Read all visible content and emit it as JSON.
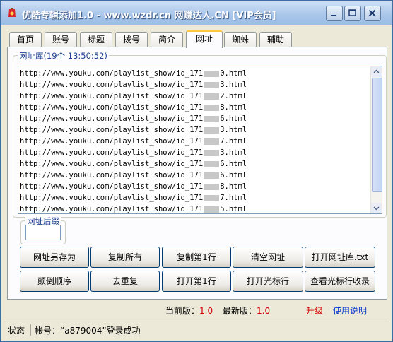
{
  "window": {
    "title": "优酷专辑添加1.0 - www.wzdr.cn 网赚达人.CN [VIP会员]"
  },
  "tabs": [
    "首页",
    "账号",
    "标题",
    "拨号",
    "简介",
    "网址",
    "蜘蛛",
    "辅助"
  ],
  "active_tab": "网址",
  "url_group": {
    "title": "网址库(19个 13:50:52)",
    "rows": [
      {
        "prefix": "http://www.youku.com/playlist_show/id_171",
        "suffix": "0.html"
      },
      {
        "prefix": "http://www.youku.com/playlist_show/id_171",
        "suffix": "3.html"
      },
      {
        "prefix": "http://www.youku.com/playlist_show/id_171",
        "suffix": "2.html"
      },
      {
        "prefix": "http://www.youku.com/playlist_show/id_171",
        "suffix": "8.html"
      },
      {
        "prefix": "http://www.youku.com/playlist_show/id_171",
        "suffix": "6.html"
      },
      {
        "prefix": "http://www.youku.com/playlist_show/id_171",
        "suffix": "3.html"
      },
      {
        "prefix": "http://www.youku.com/playlist_show/id_171",
        "suffix": "7.html"
      },
      {
        "prefix": "http://www.youku.com/playlist_show/id_171",
        "suffix": "3.html"
      },
      {
        "prefix": "http://www.youku.com/playlist_show/id_171",
        "suffix": "6.html"
      },
      {
        "prefix": "http://www.youku.com/playlist_show/id_171",
        "suffix": "6.html"
      },
      {
        "prefix": "http://www.youku.com/playlist_show/id_171",
        "suffix": "8.html"
      },
      {
        "prefix": "http://www.youku.com/playlist_show/id_171",
        "suffix": "7.html"
      },
      {
        "prefix": "http://www.youku.com/playlist_show/id_171",
        "suffix": "5.html"
      }
    ]
  },
  "suffix_group": {
    "title": "网址后缀",
    "value": ""
  },
  "buttons": {
    "save_as": "网址另存为",
    "copy_all": "复制所有",
    "copy_first": "复制第1行",
    "clear": "清空网址",
    "open_txt": "打开网址库.txt",
    "reverse": "颠倒顺序",
    "dedupe": "去重复",
    "open_first": "打开第1行",
    "open_cursor": "打开光标行",
    "view_cursor": "查看光标行收录"
  },
  "version": {
    "current_label": "当前版：",
    "current_value": "1.0",
    "latest_label": "最新版：",
    "latest_value": "1.0",
    "upgrade": "升级",
    "help": "使用说明"
  },
  "status": {
    "label": "状态",
    "message": "帐号：“a879004”登录成功"
  },
  "colors": {
    "title_gradient": "#a9c6ea",
    "accent_red": "#d40000",
    "link_blue": "#0033cc",
    "tab_active_border": "#ffc73c"
  }
}
